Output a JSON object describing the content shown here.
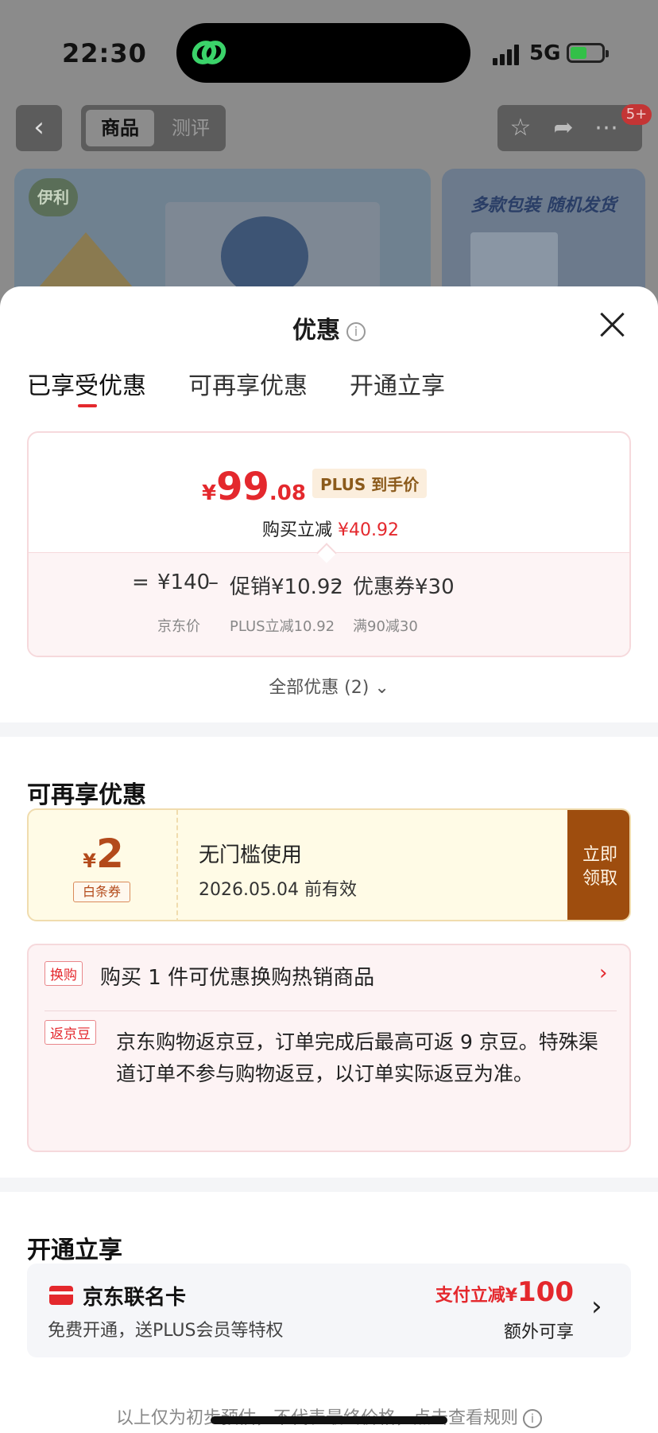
{
  "status": {
    "time": "22:30",
    "network": "5G"
  },
  "nav": {
    "tab_product": "商品",
    "tab_review": "测评",
    "badge": "5+"
  },
  "banner": {
    "side_title": "多款包装 随机发货",
    "brand": "伊利"
  },
  "sheet": {
    "title": "优惠",
    "info_glyph": "i"
  },
  "tabs": [
    "已享受优惠",
    "可再享优惠",
    "开通立享"
  ],
  "price": {
    "currency": "¥",
    "integer": "99",
    "decimal": ".08",
    "plus_tag": "PLUS 到手价",
    "reduce_label": "购买立减",
    "reduce_value": "¥40.92"
  },
  "formula": {
    "eq": "=",
    "base": "¥140",
    "base_label": "京东价",
    "minus": "–",
    "promo": "促销¥10.92",
    "promo_label": "PLUS立减10.92",
    "coupon": "优惠券¥30",
    "coupon_label": "满90减30"
  },
  "all_deals": "全部优惠 (2)",
  "more": {
    "title": "可再享优惠",
    "coupon": {
      "currency": "¥",
      "amount": "2",
      "tag": "白条券",
      "name": "无门槛使用",
      "expiry": "2026.05.04 前有效",
      "btn_line1": "立即",
      "btn_line2": "领取"
    },
    "swap_tag": "换购",
    "swap_text": "购买 1 件可优惠换购热销商品",
    "bean_tag": "返京豆",
    "bean_text": "京东购物返京豆，订单完成后最高可返 9 京豆。特殊渠道订单不参与购物返豆，以订单实际返豆为准。"
  },
  "open": {
    "title": "开通立享",
    "card_name": "京东联名卡",
    "card_desc": "免费开通，送PLUS会员等特权",
    "promo_text": "支付立减¥",
    "promo_amount": "100",
    "extra": "额外可享"
  },
  "footer": "以上仅为初步预估，不代表最终价格，点击查看规则",
  "colors": {
    "accent": "#e4282d",
    "coupon_btn": "#9e4d0e",
    "plus_tag_bg": "#fbeedd"
  }
}
